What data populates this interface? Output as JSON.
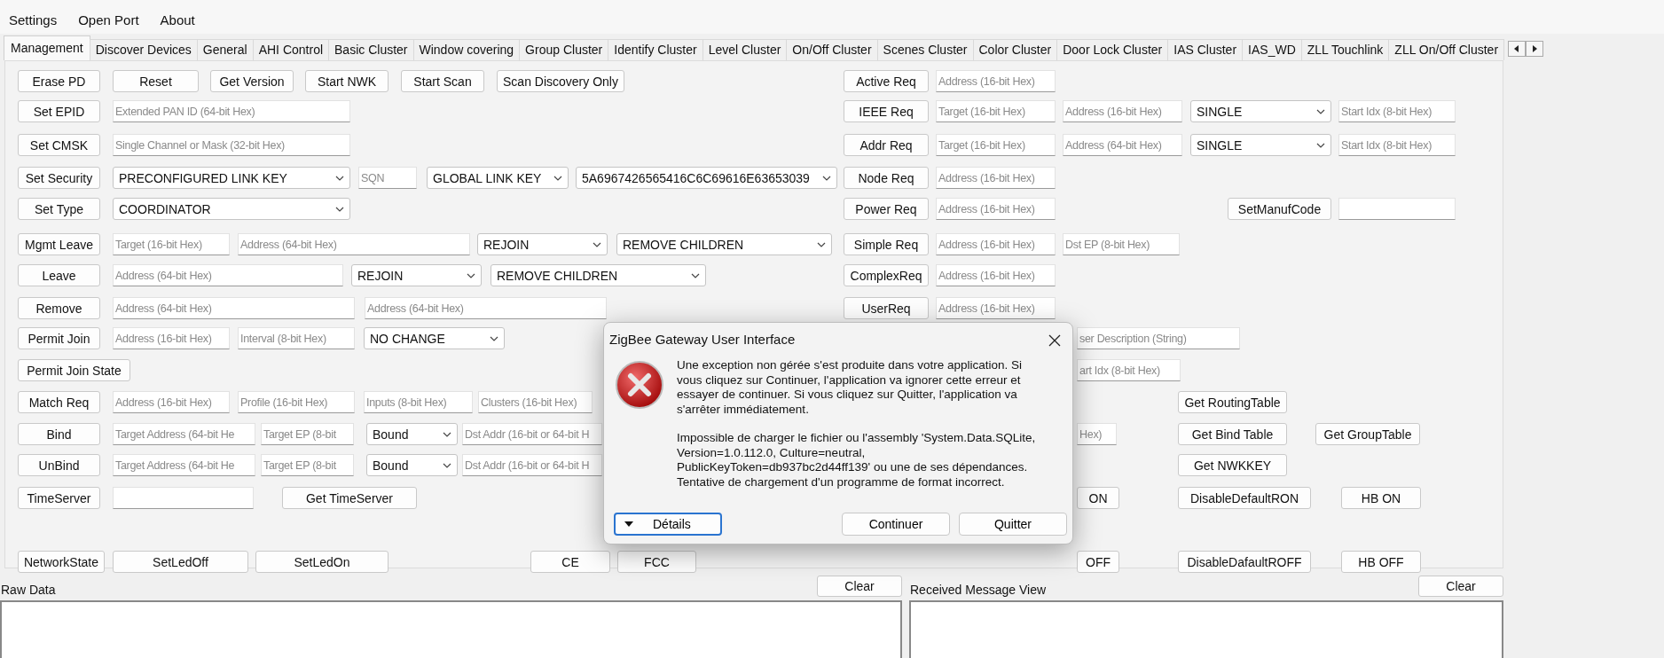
{
  "menu": [
    "Settings",
    "Open Port",
    "About"
  ],
  "tabs": [
    {
      "label": "Management",
      "selected": true
    },
    {
      "label": "Discover Devices",
      "selected": false
    },
    {
      "label": "General",
      "selected": false
    },
    {
      "label": "AHI Control",
      "selected": false
    },
    {
      "label": "Basic Cluster",
      "selected": false
    },
    {
      "label": "Window covering",
      "selected": false
    },
    {
      "label": "Group Cluster",
      "selected": false
    },
    {
      "label": "Identify Cluster",
      "selected": false
    },
    {
      "label": "Level Cluster",
      "selected": false
    },
    {
      "label": "On/Off Cluster",
      "selected": false
    },
    {
      "label": "Scenes Cluster",
      "selected": false
    },
    {
      "label": "Color Cluster",
      "selected": false
    },
    {
      "label": "Door Lock Cluster",
      "selected": false
    },
    {
      "label": "IAS Cluster",
      "selected": false
    },
    {
      "label": "IAS_WD",
      "selected": false
    },
    {
      "label": "ZLL Touchlink",
      "selected": false
    },
    {
      "label": "ZLL On/Off Cluster",
      "selected": false
    }
  ],
  "form_rows": [
    {
      "controls": [
        {
          "kind": "button",
          "label": "Erase PD"
        },
        {
          "kind": "button",
          "label": "Reset"
        },
        {
          "kind": "button",
          "label": "Get Version"
        },
        {
          "kind": "button",
          "label": "Start NWK"
        },
        {
          "kind": "button",
          "label": "Start Scan"
        },
        {
          "kind": "button",
          "label": "Scan Discovery Only"
        },
        {
          "kind": "button",
          "label": "Active Req"
        },
        {
          "kind": "field",
          "placeholder": "Address (16-bit Hex)"
        }
      ]
    },
    {
      "controls": [
        {
          "kind": "button",
          "label": "Set EPID"
        },
        {
          "kind": "field",
          "placeholder": "Extended PAN ID (64-bit Hex)"
        },
        {
          "kind": "button",
          "label": "IEEE Req"
        },
        {
          "kind": "field",
          "placeholder": "Target (16-bit Hex)"
        },
        {
          "kind": "field",
          "placeholder": "Address (16-bit Hex)"
        },
        {
          "kind": "combo",
          "value": "SINGLE"
        },
        {
          "kind": "field",
          "placeholder": "Start Idx (8-bit Hex)"
        }
      ]
    },
    {
      "controls": [
        {
          "kind": "button",
          "label": "Set CMSK"
        },
        {
          "kind": "field",
          "placeholder": "Single Channel or Mask (32-bit Hex)"
        },
        {
          "kind": "button",
          "label": "Addr Req"
        },
        {
          "kind": "field",
          "placeholder": "Target (16-bit Hex)"
        },
        {
          "kind": "field",
          "placeholder": "Address (64-bit Hex)"
        },
        {
          "kind": "combo",
          "value": "SINGLE"
        },
        {
          "kind": "field",
          "placeholder": "Start Idx (8-bit Hex)"
        }
      ]
    },
    {
      "controls": [
        {
          "kind": "button",
          "label": "Set Security"
        },
        {
          "kind": "combo",
          "value": "PRECONFIGURED LINK KEY"
        },
        {
          "kind": "field",
          "placeholder": "SQN"
        },
        {
          "kind": "combo",
          "value": "GLOBAL LINK KEY"
        },
        {
          "kind": "combo",
          "value": "5A6967426565416C6C69616E63653039"
        },
        {
          "kind": "button",
          "label": "Node Req"
        },
        {
          "kind": "field",
          "placeholder": "Address (16-bit Hex)"
        }
      ]
    },
    {
      "controls": [
        {
          "kind": "button",
          "label": "Set Type"
        },
        {
          "kind": "combo",
          "value": "COORDINATOR"
        },
        {
          "kind": "button",
          "label": "Power Req"
        },
        {
          "kind": "field",
          "placeholder": "Address (16-bit Hex)"
        },
        {
          "kind": "button",
          "label": "SetManufCode"
        },
        {
          "kind": "field"
        }
      ]
    },
    {
      "controls": [
        {
          "kind": "button",
          "label": "Mgmt Leave"
        },
        {
          "kind": "field",
          "placeholder": "Target (16-bit Hex)"
        },
        {
          "kind": "field",
          "placeholder": "Address (64-bit Hex)"
        },
        {
          "kind": "combo",
          "value": "REJOIN"
        },
        {
          "kind": "combo",
          "value": "REMOVE CHILDREN"
        },
        {
          "kind": "button",
          "label": "Simple Req"
        },
        {
          "kind": "field",
          "placeholder": "Address (16-bit Hex)"
        },
        {
          "kind": "field",
          "placeholder": "Dst EP (8-bit Hex)"
        }
      ]
    },
    {
      "controls": [
        {
          "kind": "button",
          "label": "Leave"
        },
        {
          "kind": "field",
          "placeholder": "Address (64-bit Hex)"
        },
        {
          "kind": "combo",
          "value": "REJOIN"
        },
        {
          "kind": "combo",
          "value": "REMOVE CHILDREN"
        },
        {
          "kind": "button",
          "label": "ComplexReq"
        },
        {
          "kind": "field",
          "placeholder": "Address (16-bit Hex)"
        }
      ]
    },
    {
      "controls": [
        {
          "kind": "button",
          "label": "Remove"
        },
        {
          "kind": "field",
          "placeholder": "Address (64-bit Hex)"
        },
        {
          "kind": "field",
          "placeholder": "Address (64-bit Hex)"
        },
        {
          "kind": "button",
          "label": "UserReq"
        },
        {
          "kind": "field",
          "placeholder": "Address (16-bit Hex)"
        }
      ]
    },
    {
      "controls": [
        {
          "kind": "button",
          "label": "Permit Join"
        },
        {
          "kind": "field",
          "placeholder": "Address (16-bit Hex)"
        },
        {
          "kind": "field",
          "placeholder": "Interval (8-bit Hex)"
        },
        {
          "kind": "combo",
          "value": "NO CHANGE"
        },
        {
          "kind": "field",
          "placeholder": "ser Description (String)"
        }
      ]
    },
    {
      "controls": [
        {
          "kind": "button",
          "label": "Permit Join State"
        },
        {
          "kind": "field",
          "placeholder": "art Idx (8-bit Hex)"
        }
      ]
    },
    {
      "controls": [
        {
          "kind": "button",
          "label": "Match Req"
        },
        {
          "kind": "field",
          "placeholder": "Address (16-bit Hex)"
        },
        {
          "kind": "field",
          "placeholder": "Profile (16-bit Hex)"
        },
        {
          "kind": "field",
          "placeholder": "Inputs (8-bit Hex)"
        },
        {
          "kind": "field",
          "placeholder": "Clusters (16-bit Hex)"
        },
        {
          "kind": "button",
          "label": "Get RoutingTable"
        }
      ]
    },
    {
      "controls": [
        {
          "kind": "button",
          "label": "Bind"
        },
        {
          "kind": "field",
          "placeholder": "Target Address (64-bit He"
        },
        {
          "kind": "field",
          "placeholder": "Target EP (8-bit"
        },
        {
          "kind": "combo",
          "value": "Bound"
        },
        {
          "kind": "field",
          "placeholder": "Dst Addr (16-bit or 64-bit H"
        },
        {
          "kind": "field",
          "placeholder": "Hex)"
        },
        {
          "kind": "button",
          "label": "Get Bind Table"
        },
        {
          "kind": "button",
          "label": "Get GroupTable"
        }
      ]
    },
    {
      "controls": [
        {
          "kind": "button",
          "label": "UnBind"
        },
        {
          "kind": "field",
          "placeholder": "Target Address (64-bit He"
        },
        {
          "kind": "field",
          "placeholder": "Target EP (8-bit"
        },
        {
          "kind": "combo",
          "value": "Bound"
        },
        {
          "kind": "field",
          "placeholder": "Dst Addr (16-bit or 64-bit H"
        },
        {
          "kind": "button",
          "label": "Get NWKKEY"
        }
      ]
    },
    {
      "controls": [
        {
          "kind": "button",
          "label": "TimeServer"
        },
        {
          "kind": "field"
        },
        {
          "kind": "button",
          "label": "Get TimeServer"
        },
        {
          "kind": "button",
          "label": "ON"
        },
        {
          "kind": "button",
          "label": "DisableDefaultRON"
        },
        {
          "kind": "button",
          "label": "HB ON"
        }
      ]
    },
    {
      "controls": [
        {
          "kind": "button",
          "label": "NetworkState"
        },
        {
          "kind": "button",
          "label": "SetLedOff"
        },
        {
          "kind": "button",
          "label": "SetLedOn"
        },
        {
          "kind": "button",
          "label": "CE"
        },
        {
          "kind": "button",
          "label": "FCC"
        },
        {
          "kind": "button",
          "label": "OFF"
        },
        {
          "kind": "button",
          "label": "DisableDafaultROFF"
        },
        {
          "kind": "button",
          "label": "HB OFF"
        }
      ]
    }
  ],
  "raw_data": {
    "title": "Raw Data",
    "clear_button": "Clear"
  },
  "received_message_view": {
    "title": "Received Message View",
    "clear_button": "Clear"
  },
  "dialog": {
    "title": "ZigBee Gateway User Interface",
    "paragraphs": [
      "Une exception non gérée s'est produite dans votre application. Si vous cliquez sur Continuer, l'application va ignorer cette erreur et essayer de continuer. Si vous cliquez sur Quitter, l'application va s'arrêter immédiatement.",
      "Impossible de charger le fichier ou l'assembly 'System.Data.SQLite, Version=1.0.112.0, Culture=neutral, PublicKeyToken=db937bc2d44ff139' ou une de ses dépendances. Tentative de chargement d'un programme de format incorrect."
    ],
    "details_button": "Détails",
    "buttons": [
      "Continuer",
      "Quitter"
    ]
  }
}
